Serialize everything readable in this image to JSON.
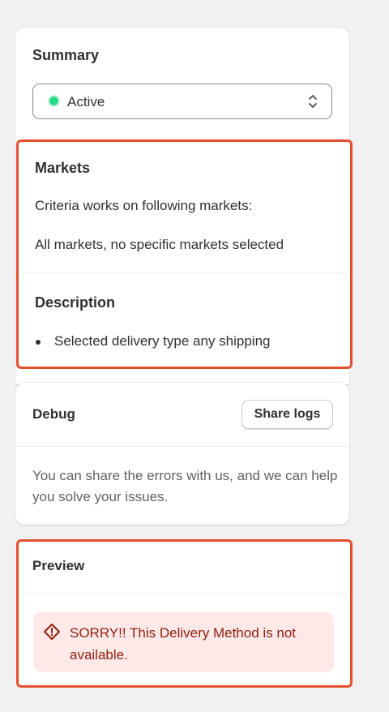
{
  "summary": {
    "title": "Summary",
    "status_value": "Active",
    "status_color": "#29d98a"
  },
  "markets": {
    "title": "Markets",
    "line1": "Criteria works on following markets:",
    "line2": "All markets, no specific markets selected"
  },
  "description": {
    "title": "Description",
    "items": [
      "Selected delivery type any shipping"
    ]
  },
  "debug": {
    "title": "Debug",
    "share_label": "Share logs",
    "help_text": "You can share the errors with us, and we can help you solve your issues."
  },
  "preview": {
    "title": "Preview",
    "banner_text": "SORRY!! This Delivery Method is not available.",
    "banner_icon": "warning-diamond-icon"
  },
  "colors": {
    "highlight": "#e4502e",
    "critical_bg": "#fee9e8",
    "critical_text": "#8e1f0b"
  }
}
